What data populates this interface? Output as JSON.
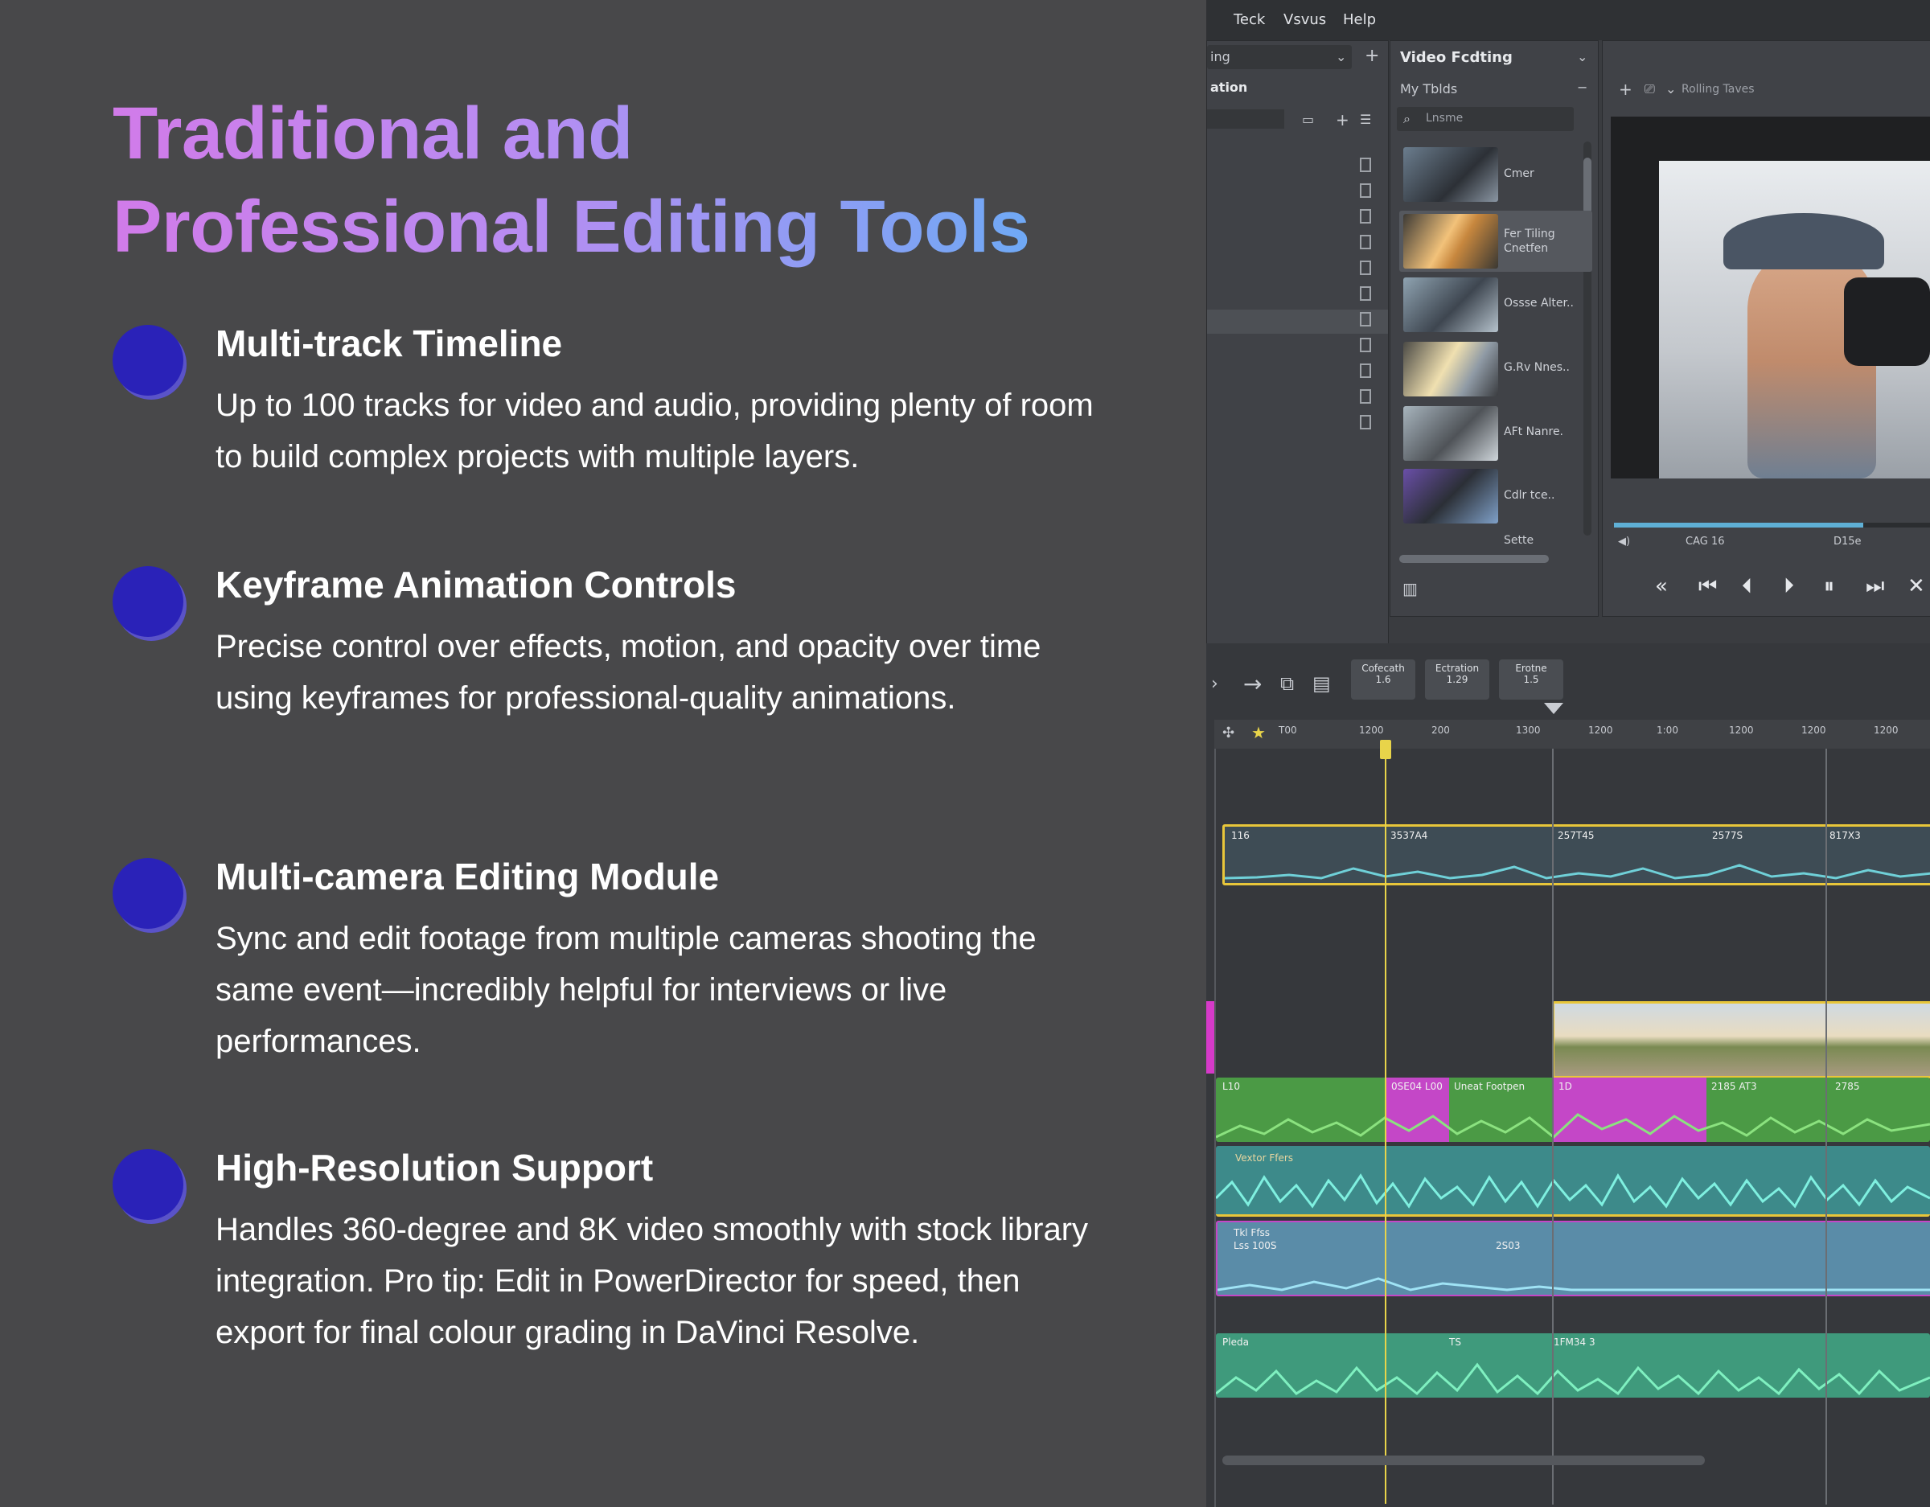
{
  "title": {
    "line1": "Traditional and",
    "line2": "Professional Editing Tools"
  },
  "features": [
    {
      "title": "Multi-track Timeline",
      "desc": "Up to 100 tracks for video and audio, providing plenty of room to build complex projects with multiple layers."
    },
    {
      "title": "Keyframe Animation Controls",
      "desc": "Precise control over effects, motion, and opacity over time using keyframes for professional-quality animations."
    },
    {
      "title": "Multi-camera Editing Module",
      "desc": "Sync and edit footage from multiple cameras shooting the same event—incredibly helpful for interviews or live performances."
    },
    {
      "title": "High-Resolution Support",
      "desc": "Handles 360-degree and 8K video smoothly with stock library integration. Pro tip: Edit in PowerDirector for speed, then export for final colour grading in DaVinci Resolve."
    }
  ],
  "colors": {
    "bullet": "#2a22b8",
    "title_gradient_start": "#d17be9",
    "title_gradient_end": "#6fa9f5",
    "background": "#48484a"
  },
  "app": {
    "menu": [
      "Teck",
      "Vsvus",
      "Help"
    ],
    "left_panel": {
      "dropdown": "ing",
      "section": "ation"
    },
    "media_panel": {
      "title": "Video Fcdting",
      "folder": "My Tblds",
      "search_placeholder": "Lnsme",
      "items": [
        "Cmer",
        "Fer Tiling Cnetfen",
        "Ossse Alter..",
        "G.Rv Nnes..",
        "AFt Nanre.",
        "Cdlr tce.."
      ],
      "footer": "Sette"
    },
    "preview_panel": {
      "title": "Rolling Taves",
      "timecode": "CAG 16",
      "speed": "D15e"
    },
    "timeline": {
      "header_boxes": [
        {
          "label": "Cofecath",
          "value": "1.6"
        },
        {
          "label": "Ectration",
          "value": "1.29"
        },
        {
          "label": "Erotne",
          "value": "1.5"
        }
      ],
      "ruler_ticks": [
        "T00",
        "1200",
        "200",
        "1300",
        "1200",
        "1:00",
        "1200",
        "1200",
        "1200"
      ],
      "clips": {
        "audio_yellow": [
          "116",
          "3537A4",
          "257T45",
          "2577S",
          "817X3"
        ],
        "green_track": [
          "L10",
          "0SE04 L00",
          "Uneat Footpen",
          "1D",
          "2185 AT3",
          "2785"
        ],
        "teal_track": [
          "Vextor Ffers"
        ],
        "blue_track": [
          "Tkl Ffss",
          "Lss 100S",
          "2S03"
        ],
        "bottom_track": [
          "Pleda",
          "TS",
          "1FM34 3"
        ]
      }
    }
  }
}
